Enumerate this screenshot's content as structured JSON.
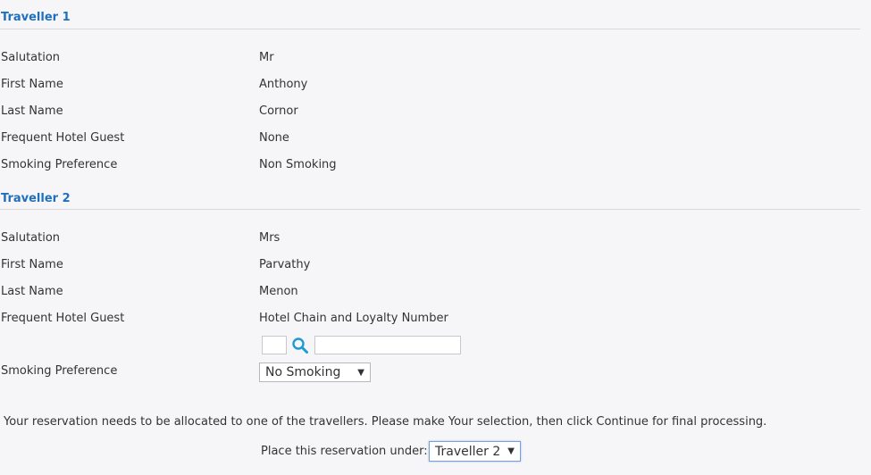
{
  "travellers": [
    {
      "title": "Traveller 1",
      "rows": [
        {
          "label": "Salutation",
          "value": "Mr"
        },
        {
          "label": "First Name",
          "value": "Anthony"
        },
        {
          "label": "Last Name",
          "value": "Cornor"
        },
        {
          "label": "Frequent Hotel Guest",
          "value": "None"
        },
        {
          "label": "Smoking Preference",
          "value": "Non Smoking"
        }
      ]
    },
    {
      "title": "Traveller 2",
      "rows": [
        {
          "label": "Salutation",
          "value": "Mrs"
        },
        {
          "label": "First Name",
          "value": "Parvathy"
        },
        {
          "label": "Last Name",
          "value": "Menon"
        },
        {
          "label": "Frequent Hotel Guest",
          "value": "Hotel Chain and Loyalty Number"
        },
        {
          "label": "Smoking Preference",
          "value": "No Smoking"
        }
      ],
      "hotel_chain_value": "",
      "loyalty_number_value": ""
    }
  ],
  "message": "Your reservation needs to be allocated to one of the travellers. Please make Your selection, then click Continue for final processing.",
  "place_label": "Place this reservation under:",
  "place_value": "Traveller 2",
  "colors": {
    "heading": "#1f6fbf",
    "search_icon": "#1e9ad6"
  }
}
